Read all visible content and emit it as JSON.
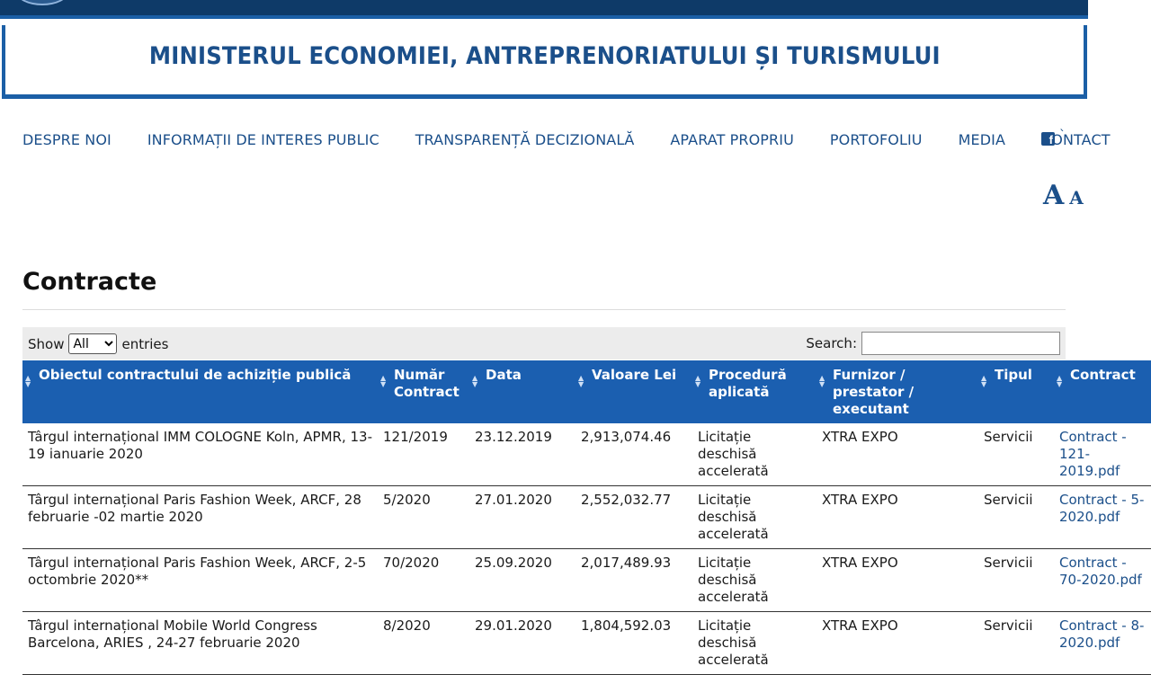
{
  "header": {
    "ministry_title": "MINISTERUL ECONOMIEI, ANTREPRENORIATULUI ȘI TURISMULUI"
  },
  "nav": {
    "items": [
      {
        "label": "DESPRE NOI"
      },
      {
        "label": "INFORMAȚII DE INTERES PUBLIC"
      },
      {
        "label": "TRANSPARENȚĂ DECIZIONALĂ"
      },
      {
        "label": "APARAT PROPRIU"
      },
      {
        "label": "PORTOFOLIU"
      },
      {
        "label": "MEDIA"
      },
      {
        "label": "CONTACT"
      }
    ],
    "facebook_glyph": "f",
    "facebook_icon": "facebook-icon"
  },
  "font_controls": {
    "increase": "A",
    "decrease": "A"
  },
  "page": {
    "title": "Contracte"
  },
  "table_controls": {
    "show_label": "Show",
    "show_selected": "All",
    "entries_label": "entries",
    "search_label": "Search:",
    "search_value": ""
  },
  "table": {
    "columns": [
      "Obiectul contractului de achiziție publică",
      "Număr Contract",
      "Data",
      "Valoare Lei",
      "Procedură aplicată",
      "Furnizor / prestator / executant",
      "Tipul",
      "Contract"
    ],
    "rows": [
      {
        "object": "Târgul internațional IMM COLOGNE Koln, APMR, 13-19 ianuarie 2020",
        "number": "121/2019",
        "date": "23.12.2019",
        "value": "2,913,074.46",
        "procedure": "Licitație deschisă accelerată",
        "supplier": "XTRA EXPO",
        "type": "Servicii",
        "contract": "Contract - 121-2019.pdf"
      },
      {
        "object": "Târgul internațional Paris Fashion Week, ARCF, 28 februarie -02 martie 2020",
        "number": "5/2020",
        "date": "27.01.2020",
        "value": "2,552,032.77",
        "procedure": "Licitație deschisă accelerată",
        "supplier": "XTRA EXPO",
        "type": "Servicii",
        "contract": "Contract - 5-2020.pdf"
      },
      {
        "object": "Târgul internațional Paris Fashion Week, ARCF, 2-5 octombrie 2020**",
        "number": "70/2020",
        "date": "25.09.2020",
        "value": "2,017,489.93",
        "procedure": "Licitație deschisă accelerată",
        "supplier": "XTRA EXPO",
        "type": "Servicii",
        "contract": "Contract - 70-2020.pdf"
      },
      {
        "object": "Târgul internațional Mobile World Congress Barcelona, ARIES , 24-27 februarie 2020",
        "number": "8/2020",
        "date": "29.01.2020",
        "value": "1,804,592.03",
        "procedure": "Licitație deschisă accelerată",
        "supplier": "XTRA EXPO",
        "type": "Servicii",
        "contract": "Contract - 8-2020.pdf"
      }
    ]
  },
  "colors": {
    "brand_dark": "#0e3a68",
    "brand": "#1b5fa6",
    "header_bg": "#1b5fb0",
    "link": "#1b4f8a"
  }
}
